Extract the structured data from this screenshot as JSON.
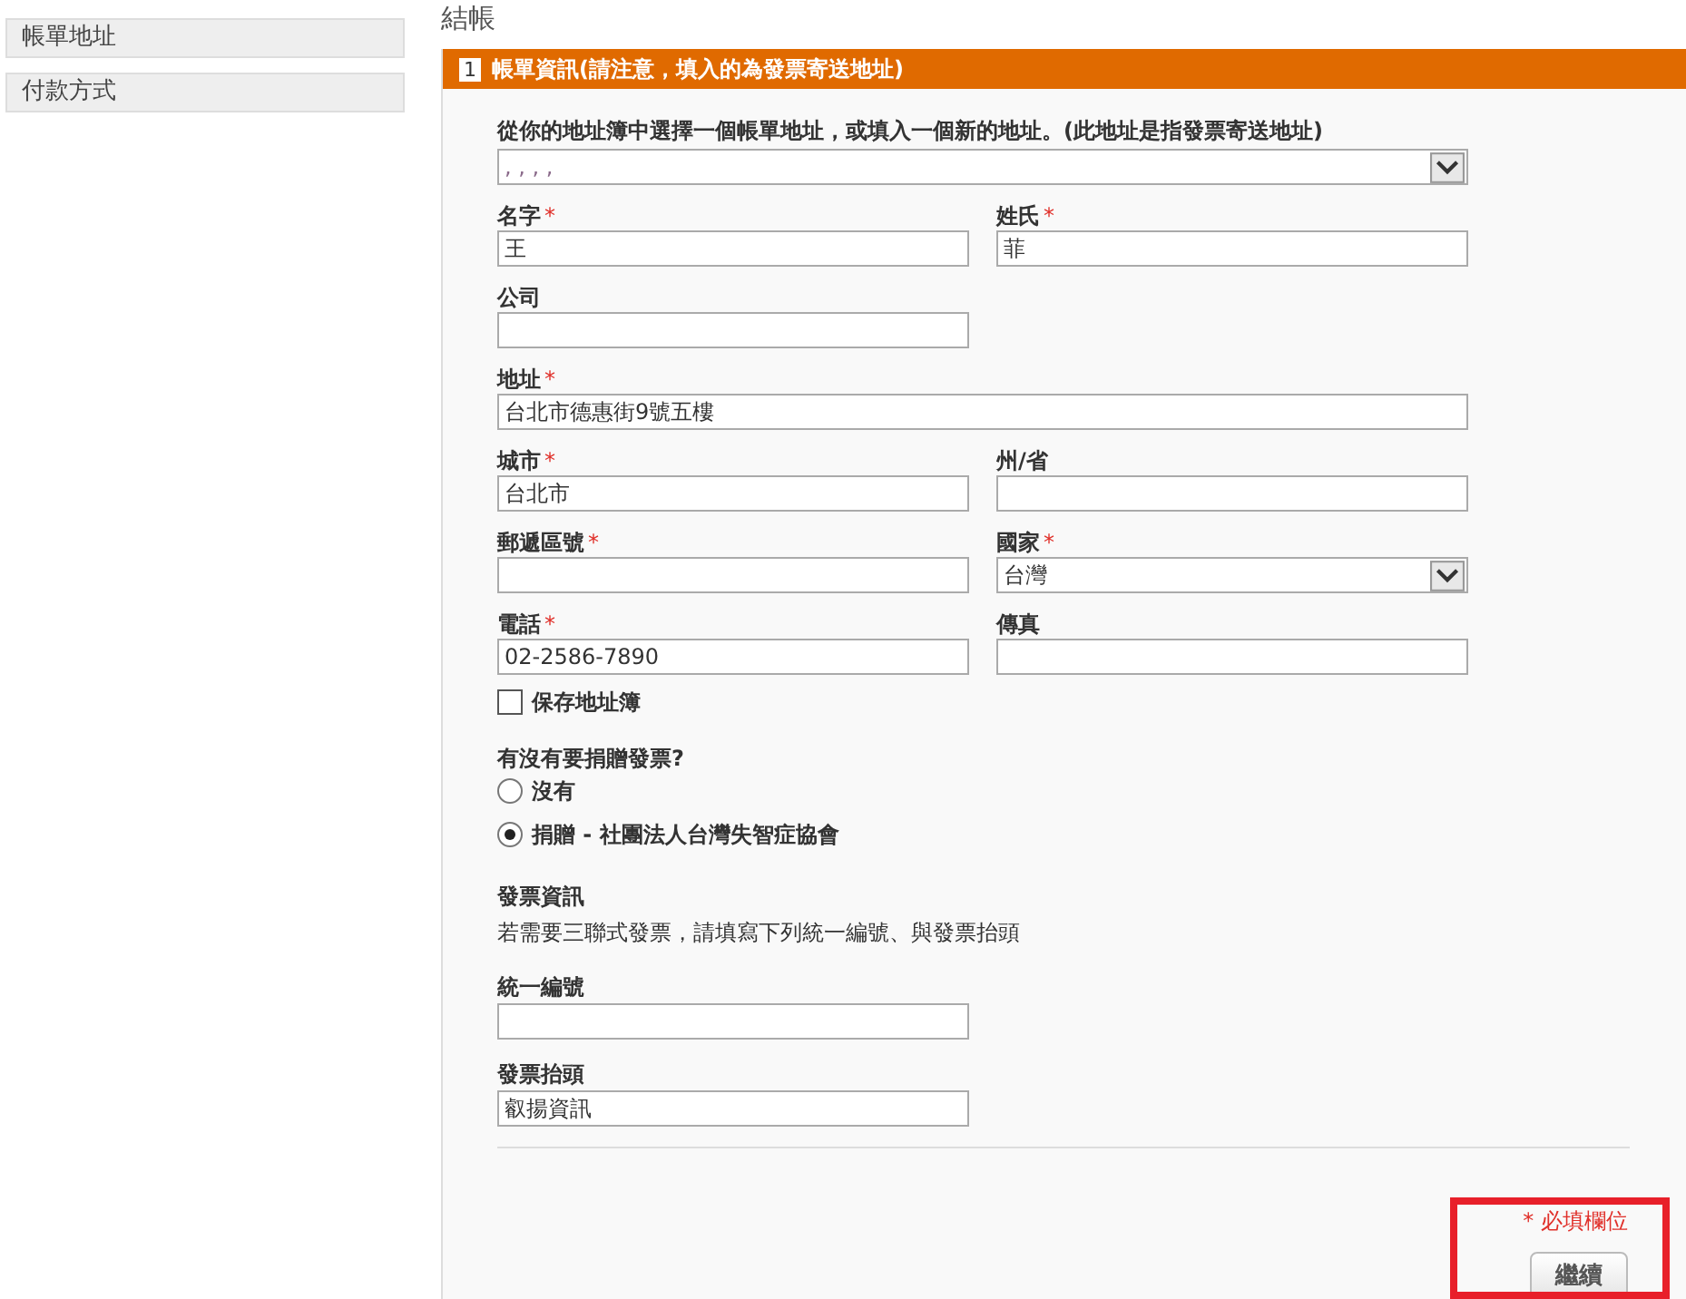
{
  "sidebar": {
    "items": [
      {
        "label": "帳單地址"
      },
      {
        "label": "付款方式"
      }
    ]
  },
  "page_title": "結帳",
  "section": {
    "number": "1",
    "title": "帳單資訊(請注意，填入的為發票寄送地址)"
  },
  "address_book": {
    "label": "從你的地址簿中選擇一個帳單地址，或填入一個新的地址。(此地址是指發票寄送地址)",
    "value": ", , , ,"
  },
  "field_rows": [
    [
      {
        "kind": "text",
        "label": "名字",
        "required": true,
        "value": "王"
      },
      {
        "kind": "text",
        "label": "姓氏",
        "required": true,
        "value": "菲"
      }
    ],
    [
      {
        "kind": "text",
        "label": "公司",
        "required": false
      }
    ],
    [
      {
        "kind": "wide-text",
        "label": "地址",
        "required": true,
        "value": "台北市德惠街9號五樓"
      }
    ],
    [
      {
        "kind": "text",
        "label": "城市",
        "required": true,
        "value": "台北市"
      },
      {
        "kind": "text",
        "label": "州/省",
        "required": false
      }
    ],
    [
      {
        "kind": "text",
        "label": "郵遞區號",
        "required": true
      },
      {
        "kind": "select",
        "label": "國家",
        "required": true,
        "value": "台灣"
      }
    ],
    [
      {
        "kind": "text",
        "label": "電話",
        "required": true,
        "value": "02-2586-7890"
      },
      {
        "kind": "text",
        "label": "傳真",
        "required": false
      }
    ]
  ],
  "save_to_address_book": {
    "label": "保存地址簿",
    "checked": false
  },
  "donation": {
    "question": "有沒有要捐贈發票?",
    "options": [
      {
        "label": "沒有",
        "selected": false
      },
      {
        "label": "捐贈 - 社團法人台灣失智症協會",
        "selected": true
      }
    ]
  },
  "invoice_info": {
    "title": "發票資訊",
    "note": "若需要三聯式發票，請填寫下列統一編號、與發票抬頭"
  },
  "invoice_fields": [
    {
      "label": "統一編號"
    },
    {
      "label": "發票抬頭",
      "value": "叡揚資訊"
    }
  ],
  "required_note": {
    "mark": "*",
    "text": "必填欄位"
  },
  "continue_button": "繼續"
}
